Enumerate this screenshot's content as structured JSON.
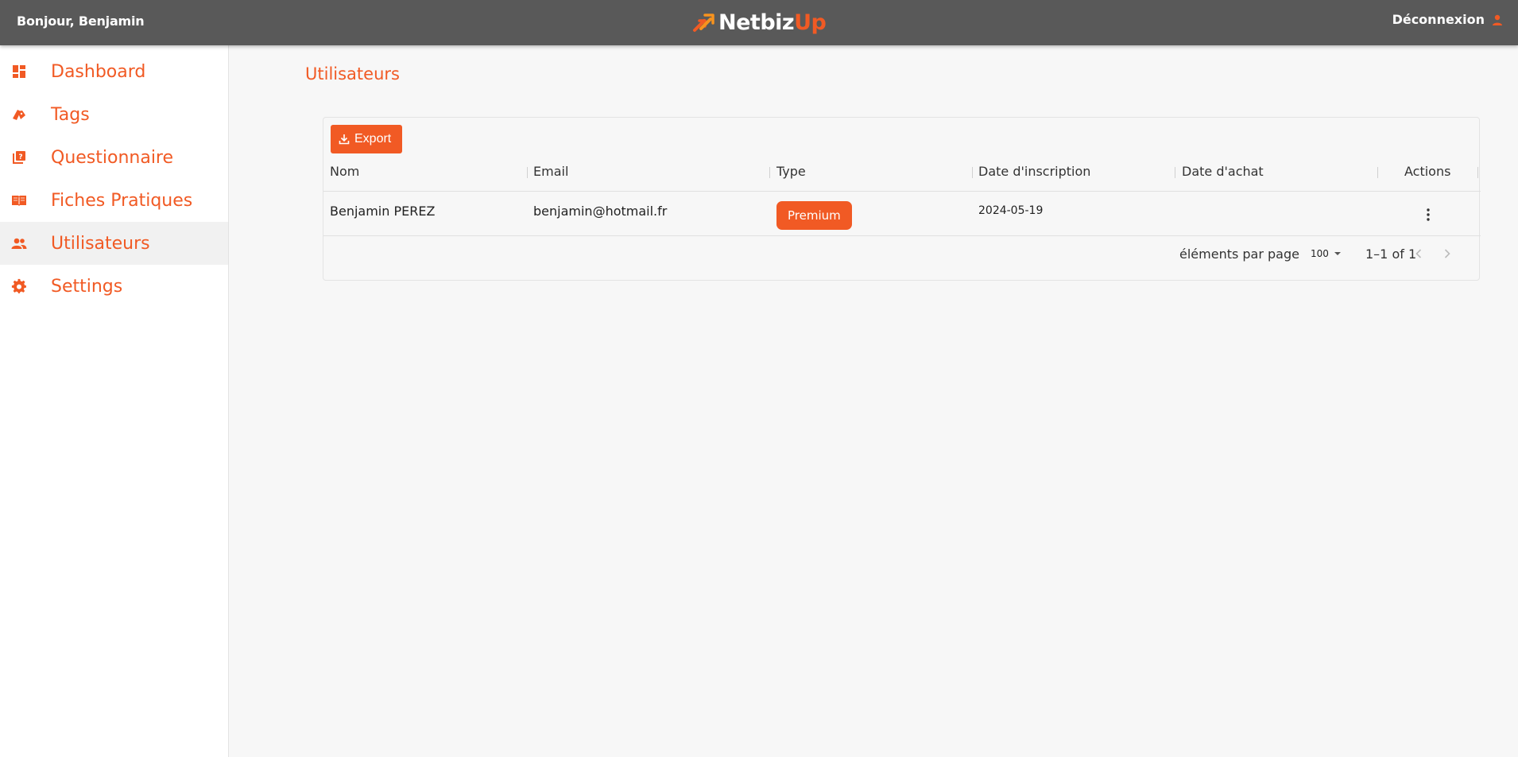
{
  "header": {
    "greeting": "Bonjour, Benjamin",
    "brand_part1": "Netbiz",
    "brand_part2": "Up",
    "logout_label": "Déconnexion"
  },
  "sidebar": {
    "items": [
      {
        "label": "Dashboard",
        "icon": "dashboard-icon"
      },
      {
        "label": "Tags",
        "icon": "tags-icon"
      },
      {
        "label": "Questionnaire",
        "icon": "questionnaire-icon"
      },
      {
        "label": "Fiches Pratiques",
        "icon": "book-icon"
      },
      {
        "label": "Utilisateurs",
        "icon": "users-icon",
        "active": true
      },
      {
        "label": "Settings",
        "icon": "gear-icon"
      }
    ]
  },
  "main": {
    "title": "Utilisateurs",
    "export_label": "Export",
    "columns": [
      "Nom",
      "Email",
      "Type",
      "Date d'inscription",
      "Date d'achat",
      "Actions"
    ],
    "rows": [
      {
        "name": "Benjamin PEREZ",
        "email": "benjamin@hotmail.fr",
        "type": "Premium",
        "signup_date": "2024-05-19",
        "purchase_date": ""
      }
    ],
    "paginator": {
      "label": "éléments par page",
      "page_size": "100",
      "range": "1–1 of 1"
    }
  },
  "colors": {
    "accent": "#f15a24",
    "header_bg": "#595959",
    "page_bg": "#f7f7f7"
  }
}
